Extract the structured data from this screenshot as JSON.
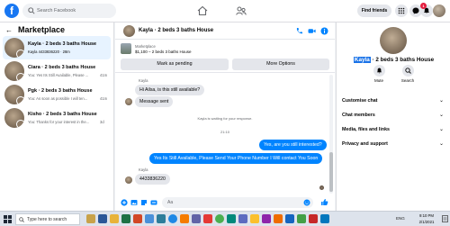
{
  "topbar": {
    "logo": "f",
    "search_placeholder": "Search Facebook",
    "find_friends": "Find friends",
    "notification_count": "1"
  },
  "sidebar": {
    "back": "←",
    "title": "Marketplace",
    "conversations": [
      {
        "name": "Kayla · 2 beds 3 baths House",
        "preview": "Kayla 4433836220 · 28m",
        "time": ""
      },
      {
        "name": "Ciara · 2 beds 3 baths House",
        "preview": "You: Yes Its Still Available, Please ...",
        "time": "41m"
      },
      {
        "name": "Pgk · 2 beds 3 baths House",
        "preview": "You: As soon as possible I will ten...",
        "time": "41m"
      },
      {
        "name": "Kisho · 2 beds 3 baths House",
        "preview": "You: Thanks for your interest in the...",
        "time": "3d"
      }
    ]
  },
  "chat": {
    "header_name": "Kayla · 2 beds 3 baths House",
    "listing_label": "Marketplace",
    "listing_price": "$1,100 – 2 beds 3 baths House",
    "mark_pending": "Mark as pending",
    "more_options": "More Options",
    "messages": {
      "sender1": "Kayla",
      "msg1": "Hi Ailsa, is this still available?",
      "msg2": "Message sent",
      "waiting": "Kayla is waiting for your response.",
      "time": "21:10",
      "out1": "Yes, are you still interested?",
      "out2": "Yes Its Still Available, Please Send Your Phone Number I Will contact You Soon",
      "sender2": "Kayla",
      "msg3": "4433836220"
    },
    "composer_placeholder": "Aa"
  },
  "right_panel": {
    "name_highlight": "Kayla",
    "name_rest": " · 2 beds 3 baths House",
    "mute": "Mute",
    "search": "Search",
    "menu": [
      "Customise chat",
      "Chat members",
      "Media, files and links",
      "Privacy and support"
    ]
  },
  "taskbar": {
    "search": "Type here to search",
    "lang": "ENG",
    "clock_time": "9:10 PM",
    "clock_date": "2/1/2021"
  },
  "colors": {
    "accent": "#1877f2",
    "outgoing_bubble": "#0084ff",
    "incoming_bubble": "#e4e6eb",
    "active_row": "#e7f3ff"
  }
}
